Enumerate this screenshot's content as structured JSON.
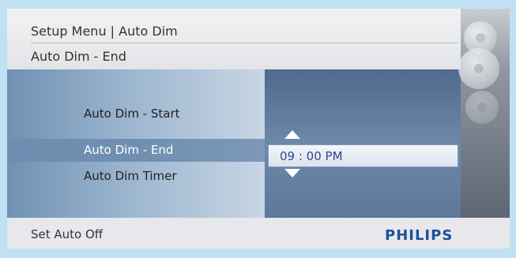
{
  "header": {
    "title": "Setup Menu | Auto Dim",
    "subtitle": "Auto Dim - End"
  },
  "menu": {
    "items": [
      {
        "label": "Auto Dim - Start"
      },
      {
        "label": "Auto Dim - End"
      },
      {
        "label": "Auto Dim Timer"
      }
    ],
    "selected_index": 1
  },
  "time_picker": {
    "value": "09 : 00  PM",
    "up_icon": "arrow-up-icon",
    "down_icon": "arrow-down-icon"
  },
  "sidebar": {
    "icons": [
      "control-icon",
      "control-icon",
      "control-icon"
    ]
  },
  "footer": {
    "status": "Set Auto Off",
    "brand": "PHILIPS"
  },
  "colors": {
    "background": "#bfe1f3",
    "brand": "#1d4f9e",
    "time_text": "#2c4a8a"
  }
}
